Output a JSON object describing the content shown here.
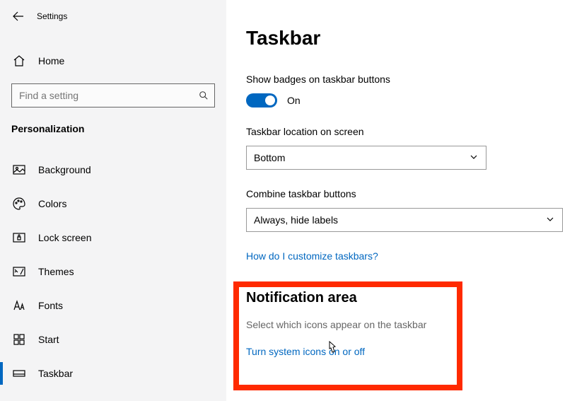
{
  "window_title": "Settings",
  "home_label": "Home",
  "search_placeholder": "Find a setting",
  "category": "Personalization",
  "nav": [
    {
      "label": "Background"
    },
    {
      "label": "Colors"
    },
    {
      "label": "Lock screen"
    },
    {
      "label": "Themes"
    },
    {
      "label": "Fonts"
    },
    {
      "label": "Start"
    },
    {
      "label": "Taskbar"
    }
  ],
  "page_title": "Taskbar",
  "badges": {
    "label": "Show badges on taskbar buttons",
    "state": "On"
  },
  "location": {
    "label": "Taskbar location on screen",
    "value": "Bottom"
  },
  "combine": {
    "label": "Combine taskbar buttons",
    "value": "Always, hide labels"
  },
  "help_link": "How do I customize taskbars?",
  "notif": {
    "heading": "Notification area",
    "select_icons": "Select which icons appear on the taskbar",
    "system_icons": "Turn system icons on or off"
  }
}
